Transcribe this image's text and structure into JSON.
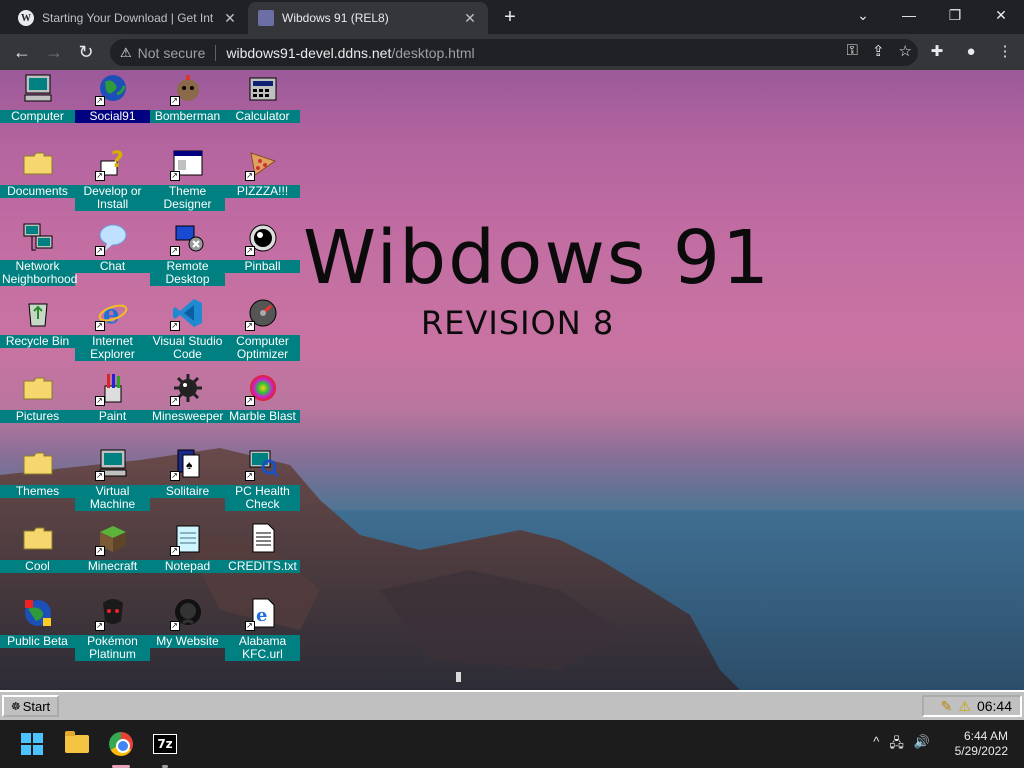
{
  "browser": {
    "tabs": [
      {
        "title": "Starting Your Download | Get Int",
        "favicon": "wordpress-icon",
        "active": false
      },
      {
        "title": "Wibdows 91 (REL8)",
        "favicon": "wibdows91-icon",
        "active": true
      }
    ],
    "new_tab": "+",
    "window_controls": {
      "tab_search": "⌄",
      "minimize": "—",
      "maximize": "❐",
      "close": "✕"
    },
    "address": {
      "security": "Not secure",
      "host": "wibdows91-devel.ddns.net",
      "path": "/desktop.html"
    }
  },
  "desktop": {
    "heading": "Wibdows 91",
    "subheading": "REVISION 8",
    "icons": [
      {
        "label": "Computer",
        "icon": "computer-icon",
        "shortcut": false
      },
      {
        "label": "Social91",
        "icon": "globe-icon",
        "shortcut": true,
        "selected": true
      },
      {
        "label": "Bomberman",
        "icon": "bomberman-icon",
        "shortcut": true
      },
      {
        "label": "Calculator",
        "icon": "calculator-icon",
        "shortcut": false
      },
      {
        "label": "Documents",
        "icon": "folder-icon",
        "shortcut": false
      },
      {
        "label": "Develop or Install",
        "icon": "help-icon",
        "shortcut": true
      },
      {
        "label": "Theme Designer",
        "icon": "window-icon",
        "shortcut": true
      },
      {
        "label": "PIZZZA!!!",
        "icon": "pizza-icon",
        "shortcut": true
      },
      {
        "label": "Network Neighborhood",
        "icon": "network-icon",
        "shortcut": false
      },
      {
        "label": "Chat",
        "icon": "chat-bubble-icon",
        "shortcut": true
      },
      {
        "label": "Remote Desktop",
        "icon": "remote-desktop-icon",
        "shortcut": true
      },
      {
        "label": "Pinball",
        "icon": "pinball-icon",
        "shortcut": true
      },
      {
        "label": "Recycle Bin",
        "icon": "recycle-bin-icon",
        "shortcut": false
      },
      {
        "label": "Internet Explorer",
        "icon": "ie-icon",
        "shortcut": true
      },
      {
        "label": "Visual Studio Code",
        "icon": "vscode-icon",
        "shortcut": true
      },
      {
        "label": "Computer Optimizer",
        "icon": "gauge-icon",
        "shortcut": true
      },
      {
        "label": "Pictures",
        "icon": "folder-icon",
        "shortcut": false
      },
      {
        "label": "Paint",
        "icon": "paint-icon",
        "shortcut": true
      },
      {
        "label": "Minesweeper",
        "icon": "mine-icon",
        "shortcut": true
      },
      {
        "label": "Marble Blast",
        "icon": "marble-icon",
        "shortcut": true
      },
      {
        "label": "Themes",
        "icon": "folder-icon",
        "shortcut": false
      },
      {
        "label": "Virtual Machine",
        "icon": "computer-icon",
        "shortcut": true
      },
      {
        "label": "Solitaire",
        "icon": "cards-icon",
        "shortcut": true
      },
      {
        "label": "PC Health Check",
        "icon": "health-check-icon",
        "shortcut": true
      },
      {
        "label": "Cool",
        "icon": "folder-icon",
        "shortcut": false
      },
      {
        "label": "Minecraft",
        "icon": "grass-block-icon",
        "shortcut": true
      },
      {
        "label": "Notepad",
        "icon": "notepad-icon",
        "shortcut": true
      },
      {
        "label": "CREDITS.txt",
        "icon": "text-file-icon",
        "shortcut": false
      },
      {
        "label": "Public Beta",
        "icon": "beta-globe-icon",
        "shortcut": false
      },
      {
        "label": "Pokémon Platinum",
        "icon": "pokemon-icon",
        "shortcut": true
      },
      {
        "label": "My Website",
        "icon": "github-icon",
        "shortcut": true
      },
      {
        "label": "Alabama KFC.url",
        "icon": "ie-shortcut-icon",
        "shortcut": true
      }
    ]
  },
  "w91_taskbar": {
    "start_label": "Start",
    "clock": "06:44",
    "tray_icons": [
      "pencil-icon",
      "warning-icon"
    ]
  },
  "os_taskbar": {
    "apps": [
      "windows-start-icon",
      "file-explorer-icon",
      "chrome-icon",
      "7zip-icon"
    ],
    "sevenzip_label": "7z",
    "tray": {
      "chevron": "^",
      "network": "🖧",
      "volume": "🔊"
    },
    "time": "6:44 AM",
    "date": "5/29/2022"
  },
  "colors": {
    "icon_label_bg": "#008080",
    "icon_label_selected_bg": "#000080",
    "w91_taskbar": "#c0c0c0",
    "browser_frame": "#202124"
  }
}
